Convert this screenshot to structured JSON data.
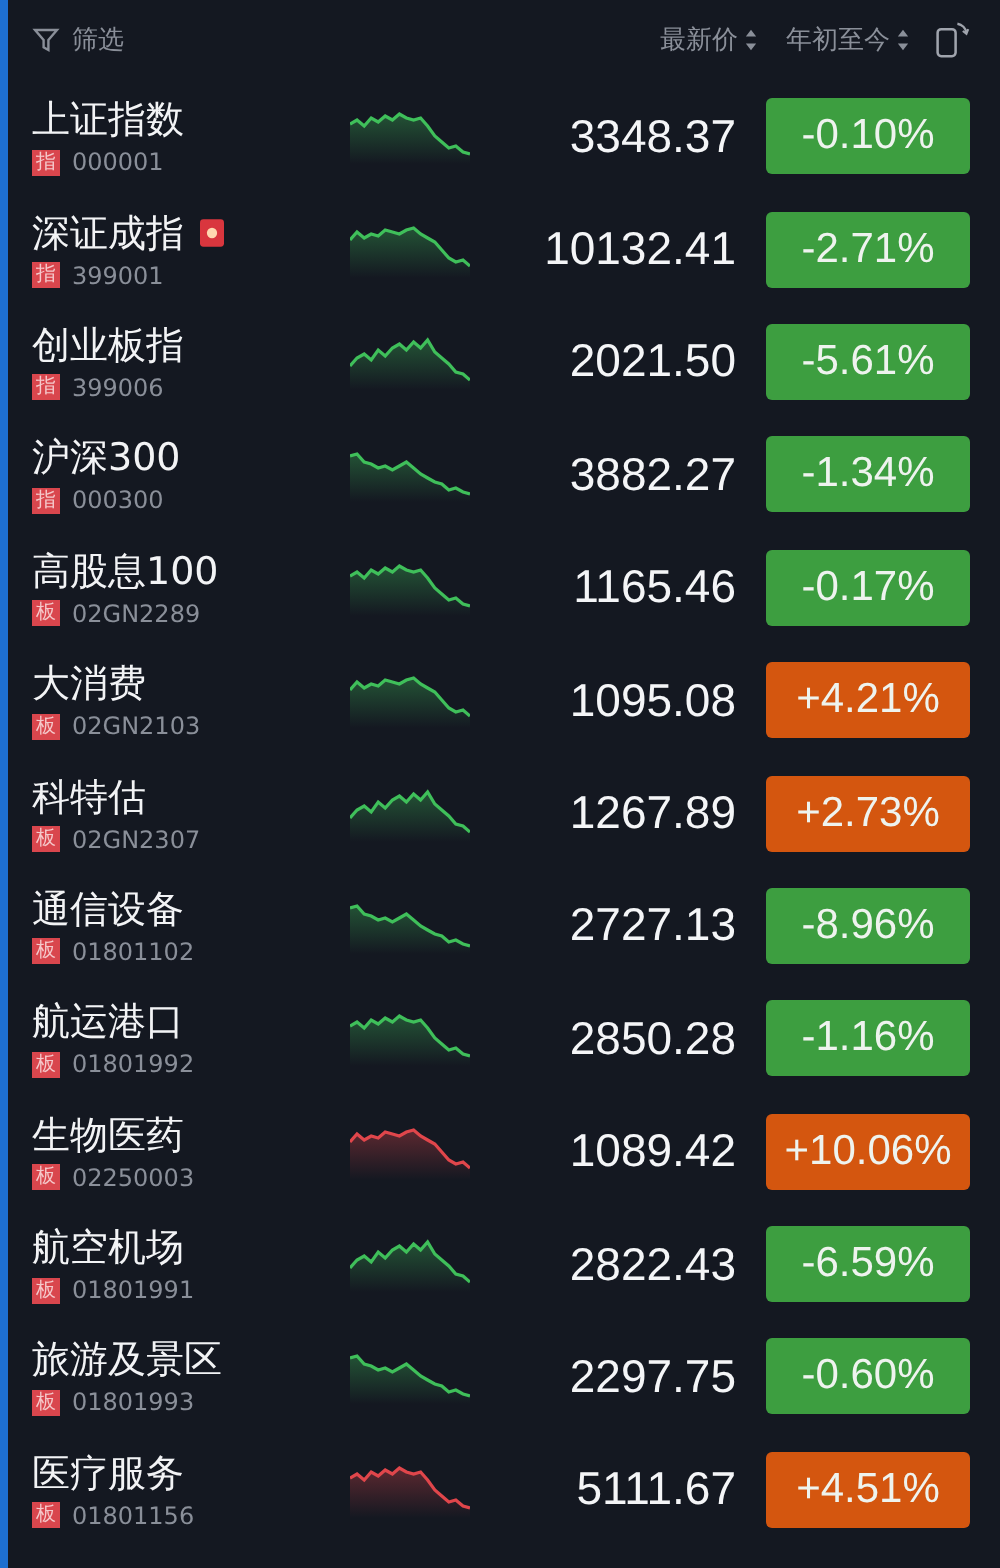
{
  "header": {
    "filter_label": "筛选",
    "columns": [
      {
        "label": "最新价"
      },
      {
        "label": "年初至今"
      }
    ]
  },
  "rows": [
    {
      "name": "上证指数",
      "tag": "指",
      "code": "000001",
      "flag": false,
      "sparkline": {
        "color": "#3fbf5a"
      },
      "price": "3348.37",
      "change": {
        "text": "-0.10%",
        "color": "#3d9e40"
      }
    },
    {
      "name": "深证成指",
      "tag": "指",
      "code": "399001",
      "flag": true,
      "sparkline": {
        "color": "#3fbf5a"
      },
      "price": "10132.41",
      "change": {
        "text": "-2.71%",
        "color": "#3d9e40"
      }
    },
    {
      "name": "创业板指",
      "tag": "指",
      "code": "399006",
      "flag": false,
      "sparkline": {
        "color": "#3fbf5a"
      },
      "price": "2021.50",
      "change": {
        "text": "-5.61%",
        "color": "#3d9e40"
      }
    },
    {
      "name": "沪深300",
      "tag": "指",
      "code": "000300",
      "flag": false,
      "sparkline": {
        "color": "#3fbf5a"
      },
      "price": "3882.27",
      "change": {
        "text": "-1.34%",
        "color": "#3d9e40"
      }
    },
    {
      "name": "高股息100",
      "tag": "板",
      "code": "02GN2289",
      "flag": false,
      "sparkline": {
        "color": "#3fbf5a"
      },
      "price": "1165.46",
      "change": {
        "text": "-0.17%",
        "color": "#3d9e40"
      }
    },
    {
      "name": "大消费",
      "tag": "板",
      "code": "02GN2103",
      "flag": false,
      "sparkline": {
        "color": "#3fbf5a"
      },
      "price": "1095.08",
      "change": {
        "text": "+4.21%",
        "color": "#d4560f"
      }
    },
    {
      "name": "科特估",
      "tag": "板",
      "code": "02GN2307",
      "flag": false,
      "sparkline": {
        "color": "#3fbf5a"
      },
      "price": "1267.89",
      "change": {
        "text": "+2.73%",
        "color": "#d4560f"
      }
    },
    {
      "name": "通信设备",
      "tag": "板",
      "code": "01801102",
      "flag": false,
      "sparkline": {
        "color": "#3fbf5a"
      },
      "price": "2727.13",
      "change": {
        "text": "-8.96%",
        "color": "#3d9e40"
      }
    },
    {
      "name": "航运港口",
      "tag": "板",
      "code": "01801992",
      "flag": false,
      "sparkline": {
        "color": "#3fbf5a"
      },
      "price": "2850.28",
      "change": {
        "text": "-1.16%",
        "color": "#3d9e40"
      }
    },
    {
      "name": "生物医药",
      "tag": "板",
      "code": "02250003",
      "flag": false,
      "sparkline": {
        "color": "#e0464b"
      },
      "price": "1089.42",
      "change": {
        "text": "+10.06%",
        "color": "#d4560f"
      }
    },
    {
      "name": "航空机场",
      "tag": "板",
      "code": "01801991",
      "flag": false,
      "sparkline": {
        "color": "#3fbf5a"
      },
      "price": "2822.43",
      "change": {
        "text": "-6.59%",
        "color": "#3d9e40"
      }
    },
    {
      "name": "旅游及景区",
      "tag": "板",
      "code": "01801993",
      "flag": false,
      "sparkline": {
        "color": "#3fbf5a"
      },
      "price": "2297.75",
      "change": {
        "text": "-0.60%",
        "color": "#3d9e40"
      }
    },
    {
      "name": "医疗服务",
      "tag": "板",
      "code": "01801156",
      "flag": false,
      "sparkline": {
        "color": "#e0464b"
      },
      "price": "5111.67",
      "change": {
        "text": "+4.51%",
        "color": "#d4560f"
      }
    }
  ]
}
